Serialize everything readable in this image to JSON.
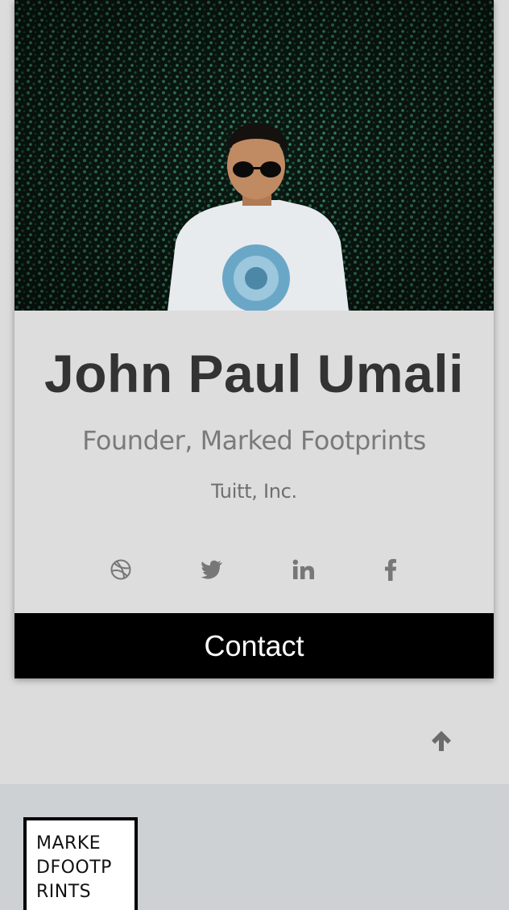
{
  "profile": {
    "name": "John Paul Umali",
    "title": "Founder, Marked Footprints",
    "company": "Tuitt, Inc.",
    "photo_alt": "portrait"
  },
  "social": [
    {
      "icon": "dribbble-icon"
    },
    {
      "icon": "twitter-icon"
    },
    {
      "icon": "linkedin-icon"
    },
    {
      "icon": "facebook-icon"
    }
  ],
  "contact": {
    "label": "Contact"
  },
  "footer": {
    "logo_lines": [
      "MARKE",
      "DFOOTP",
      "RINTS"
    ]
  },
  "colors": {
    "card_bg": "#dddddd",
    "contact_bg": "#000000",
    "footer_bg": "#cdd1d4",
    "icon_gray": "#777777"
  }
}
